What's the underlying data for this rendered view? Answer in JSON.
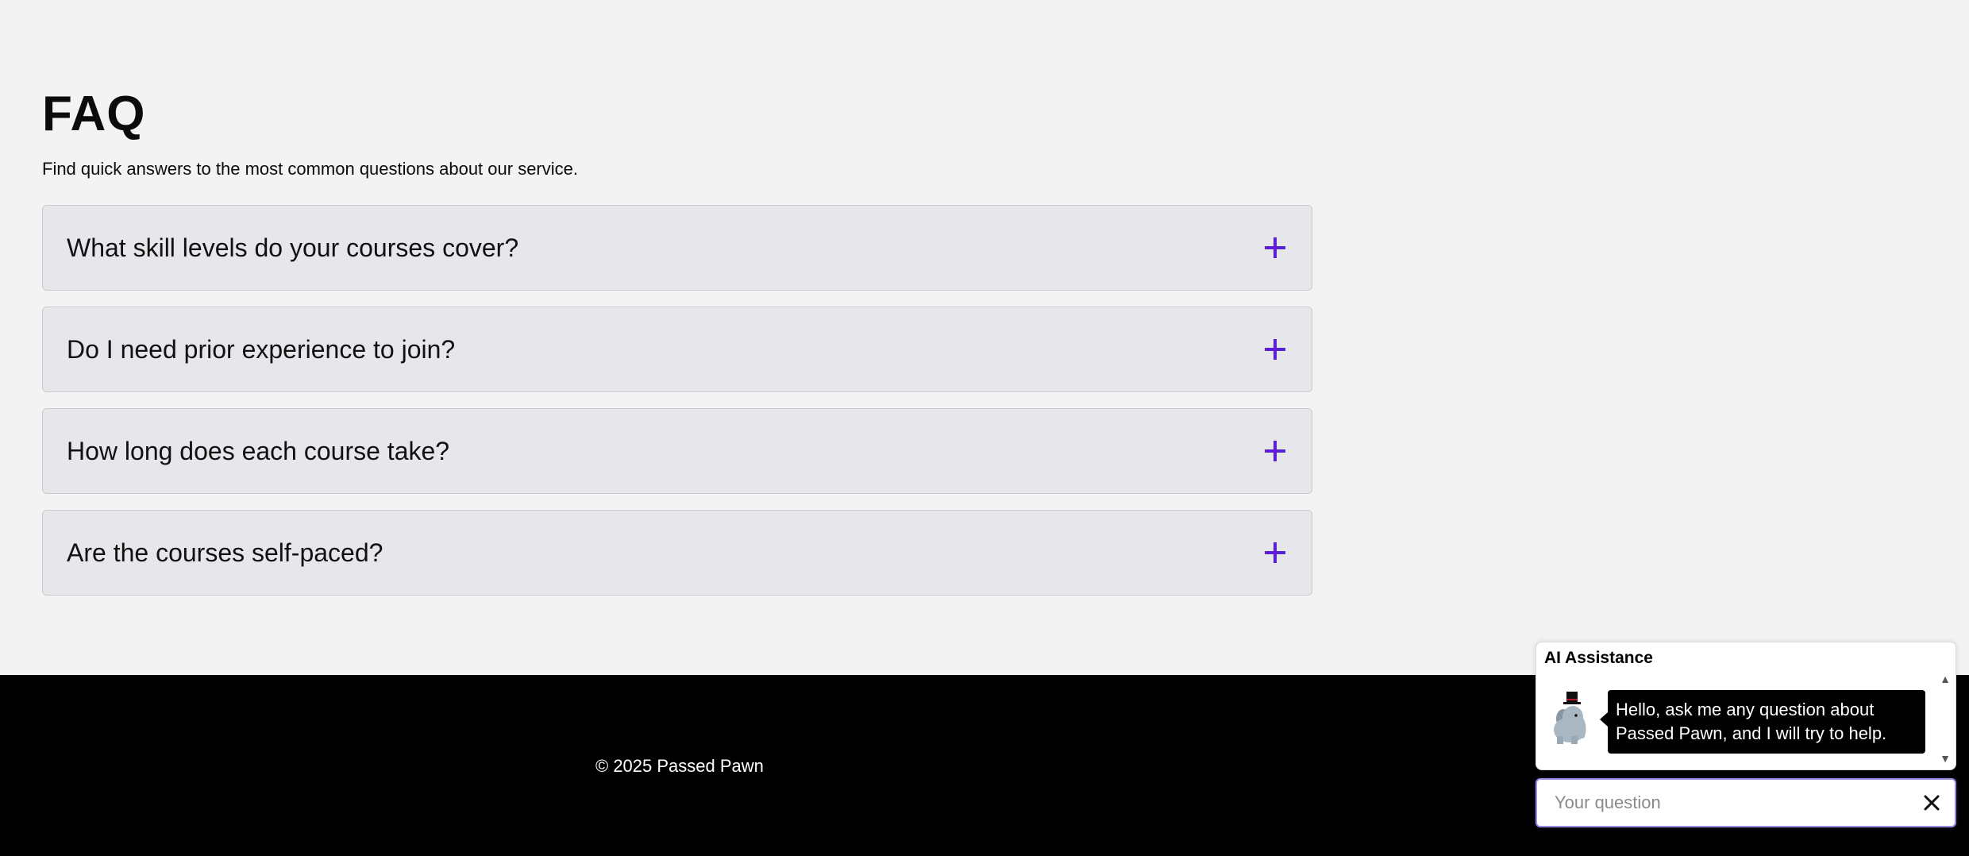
{
  "faq": {
    "title": "FAQ",
    "subtitle": "Find quick answers to the most common questions about our service.",
    "items": [
      {
        "question": "What skill levels do your courses cover?",
        "icon": "plus-icon"
      },
      {
        "question": "Do I need prior experience to join?",
        "icon": "plus-icon"
      },
      {
        "question": "How long does each course take?",
        "icon": "plus-icon"
      },
      {
        "question": "Are the courses self-paced?",
        "icon": "plus-icon"
      }
    ]
  },
  "footer": {
    "copyright": "© 2025 Passed Pawn"
  },
  "chat": {
    "title": "AI Assistance",
    "avatar_icon": "elephant-top-hat-icon",
    "greeting": "Hello, ask me any question about Passed Pawn, and I will try to help.",
    "input_placeholder": "Your question",
    "input_value": "",
    "close_icon": "close-icon"
  },
  "colors": {
    "accent": "#5b1fd6",
    "background": "#f3f3f3",
    "faq_item_bg": "#e7e6ea",
    "footer_bg": "#000000",
    "bubble_bg": "#000000"
  }
}
